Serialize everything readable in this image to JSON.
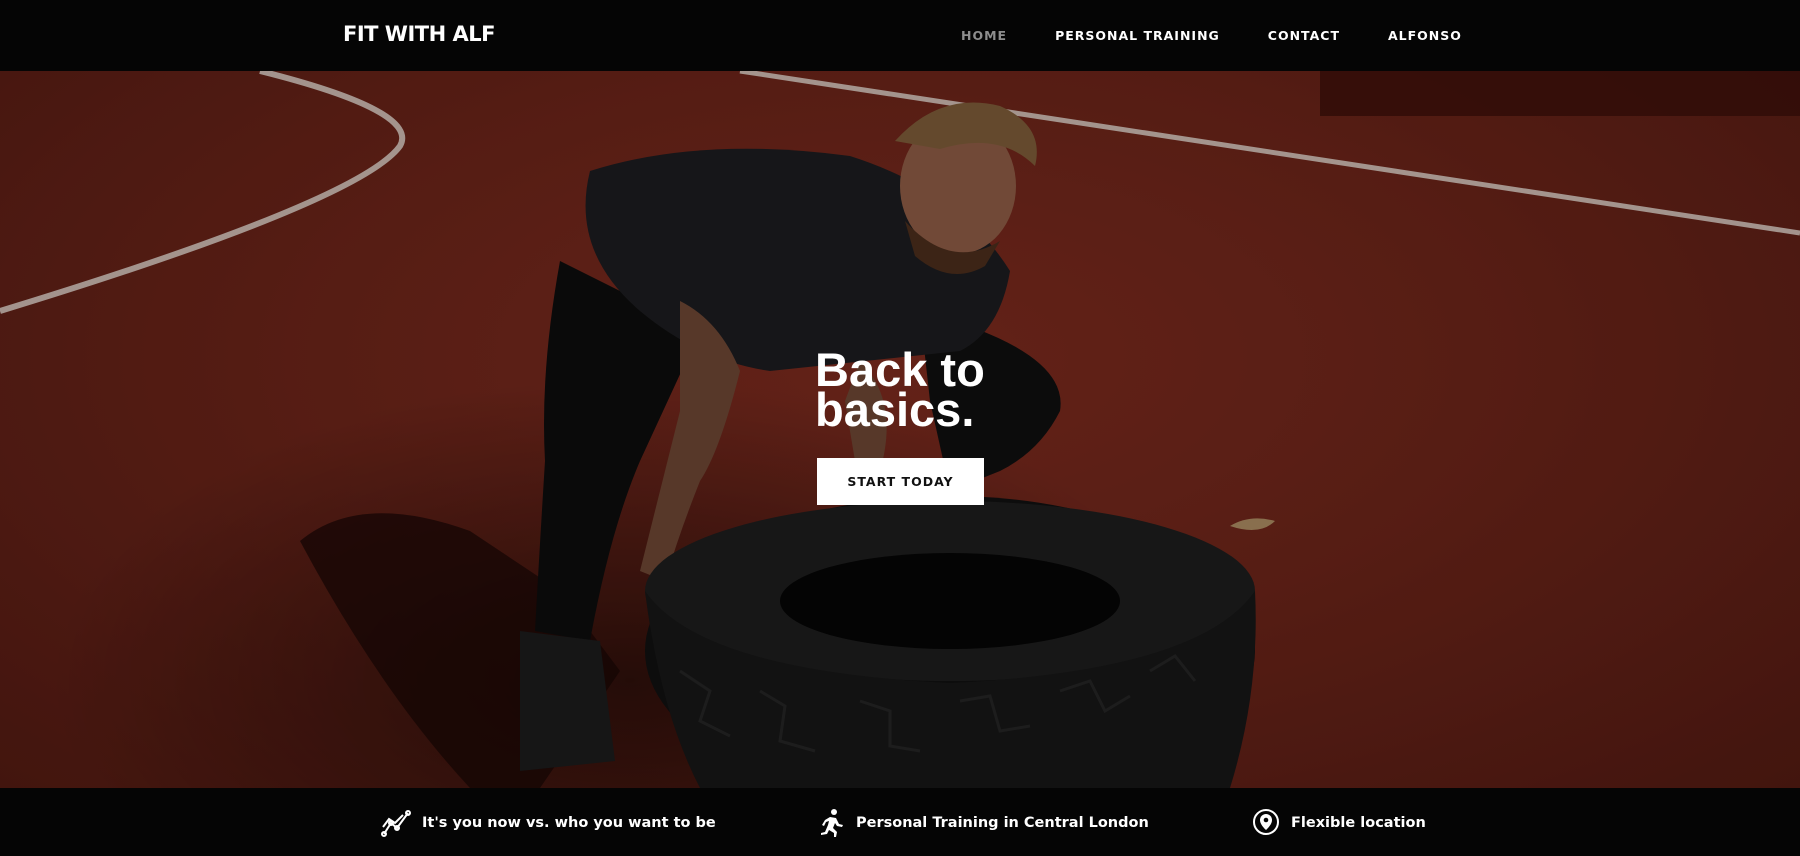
{
  "header": {
    "brand": "FIT WITH ALF",
    "nav": [
      {
        "label": "HOME",
        "active": true
      },
      {
        "label": "PERSONAL TRAINING",
        "active": false
      },
      {
        "label": "CONTACT",
        "active": false
      },
      {
        "label": "ALFONSO",
        "active": false
      }
    ]
  },
  "hero": {
    "title_line1": "Back to",
    "title_line2": "basics.",
    "cta_label": "START TODAY",
    "background_image": "man flipping tractor tire on red running track"
  },
  "features": [
    {
      "icon": "progress-chart-icon",
      "text": "It's you now vs. who you want to be"
    },
    {
      "icon": "runner-icon",
      "text": "Personal Training in Central London"
    },
    {
      "icon": "location-pin-icon",
      "text": "Flexible location"
    }
  ],
  "colors": {
    "header_bg": "#050505",
    "track_red": "#6a2419",
    "nav_active": "#8d8d8d",
    "button_bg": "#ffffff"
  }
}
